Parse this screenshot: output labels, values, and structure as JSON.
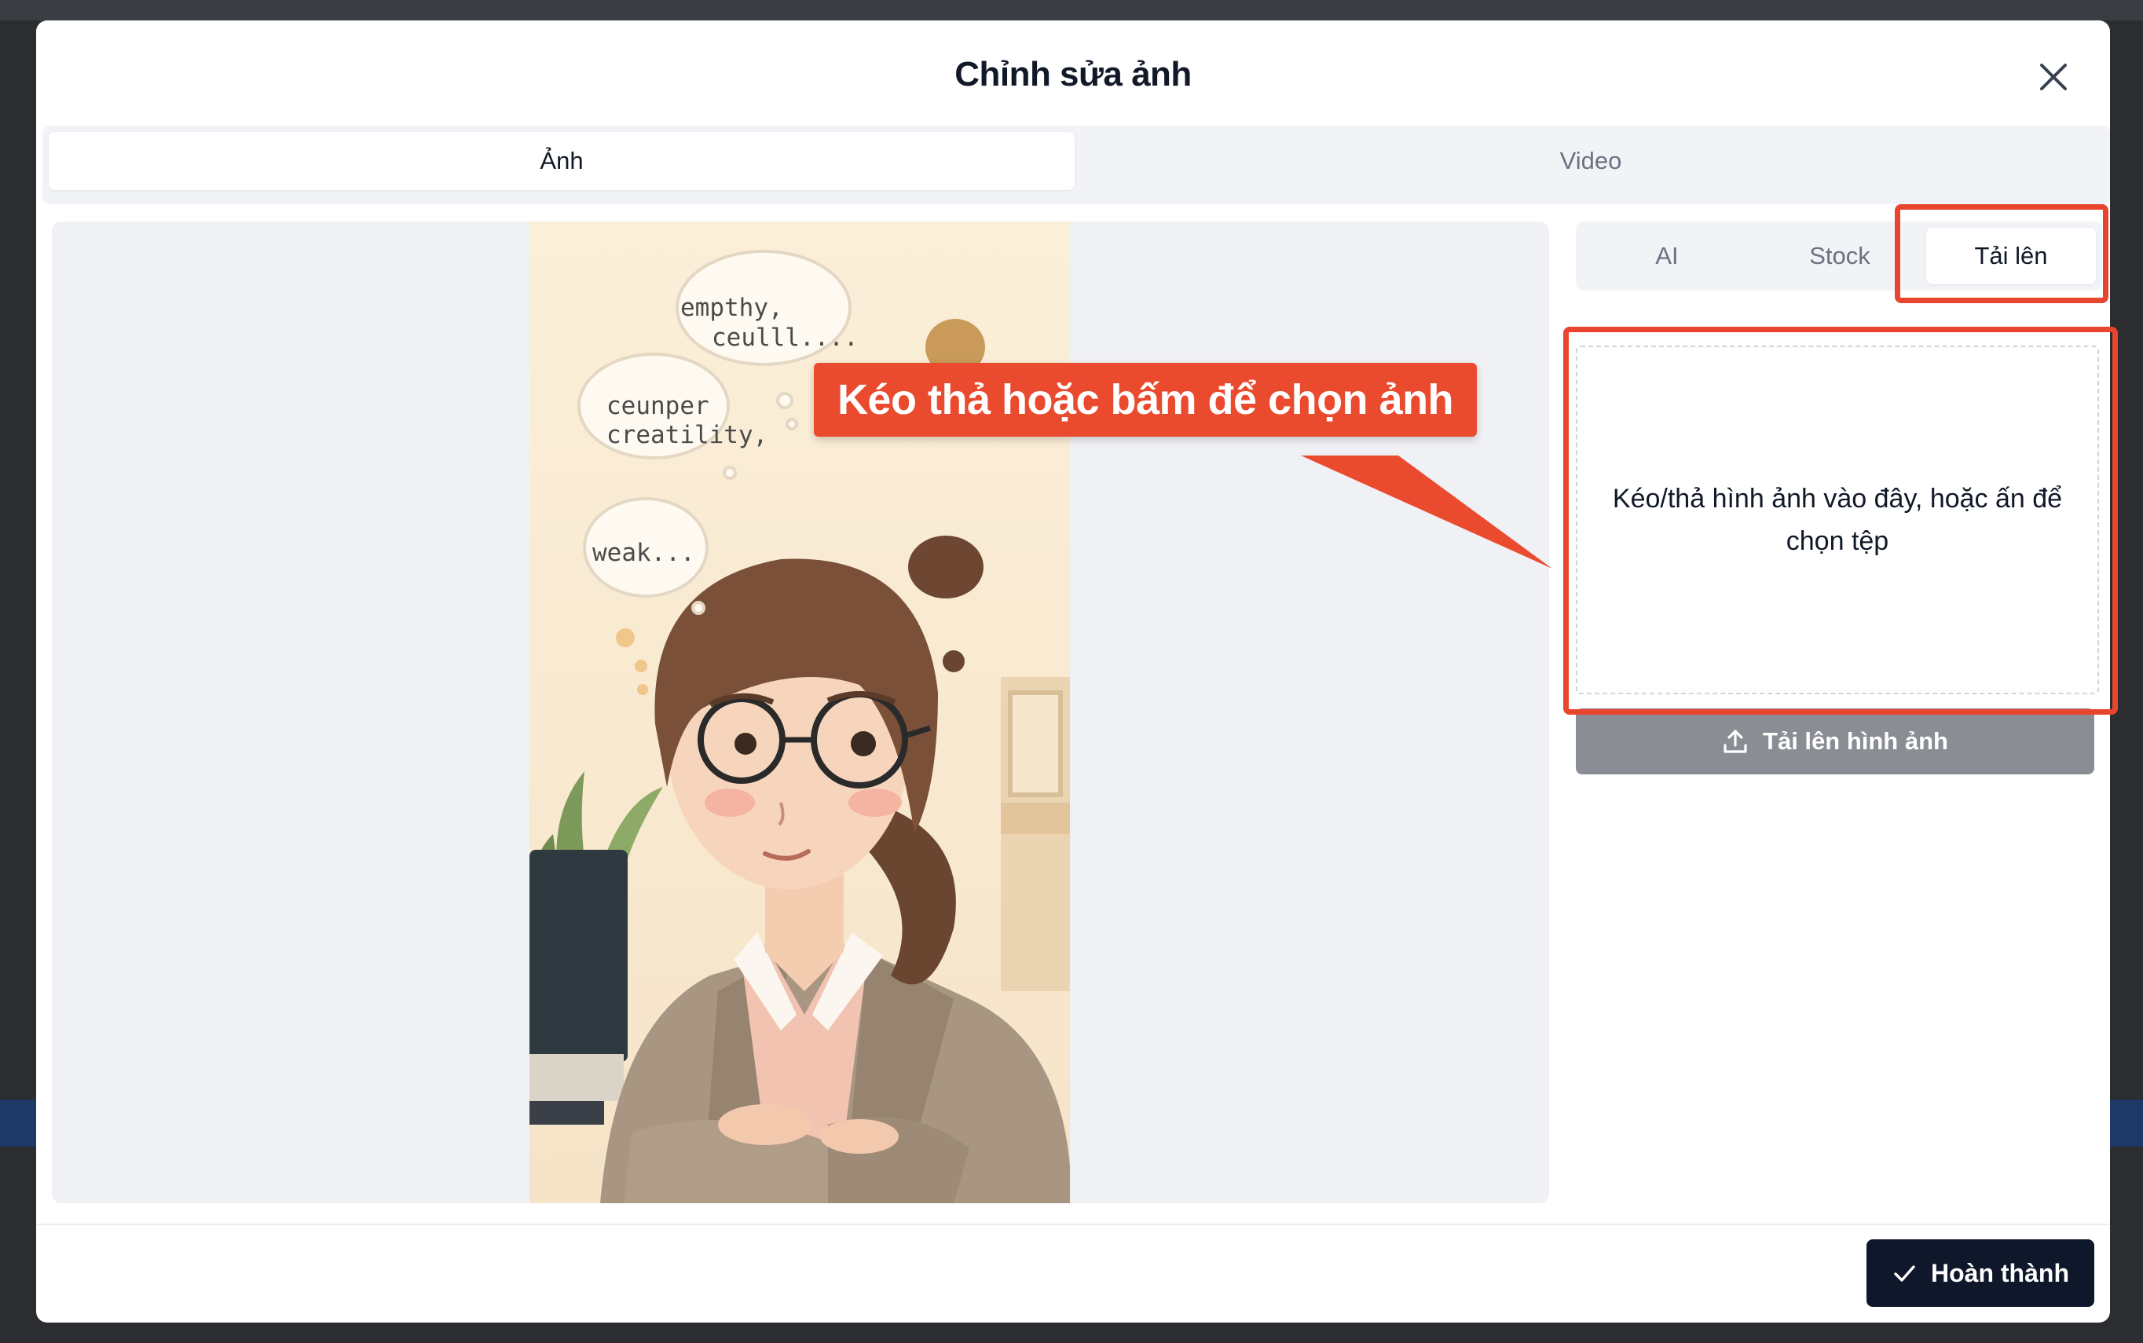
{
  "modal": {
    "title": "Chỉnh sửa ảnh"
  },
  "main_tabs": [
    {
      "label": "Ảnh",
      "active": true
    },
    {
      "label": "Video",
      "active": false
    }
  ],
  "source_tabs": [
    {
      "label": "AI",
      "active": false
    },
    {
      "label": "Stock",
      "active": false
    },
    {
      "label": "Tải lên",
      "active": true
    }
  ],
  "preview": {
    "thought_bubbles": [
      "empthy,",
      "ceulll....",
      "ceunper",
      "creatility,",
      "weak..."
    ]
  },
  "dropzone": {
    "text": "Kéo/thả hình ảnh vào đây, hoặc ấn để chọn tệp"
  },
  "upload_button": {
    "label": "Tải lên hình ảnh",
    "icon": "upload-icon"
  },
  "annotation": {
    "callout_text": "Kéo thả hoặc bấm để chọn ảnh",
    "color": "#e8452f"
  },
  "footer": {
    "done_label": "Hoàn thành",
    "done_icon": "check-icon"
  }
}
